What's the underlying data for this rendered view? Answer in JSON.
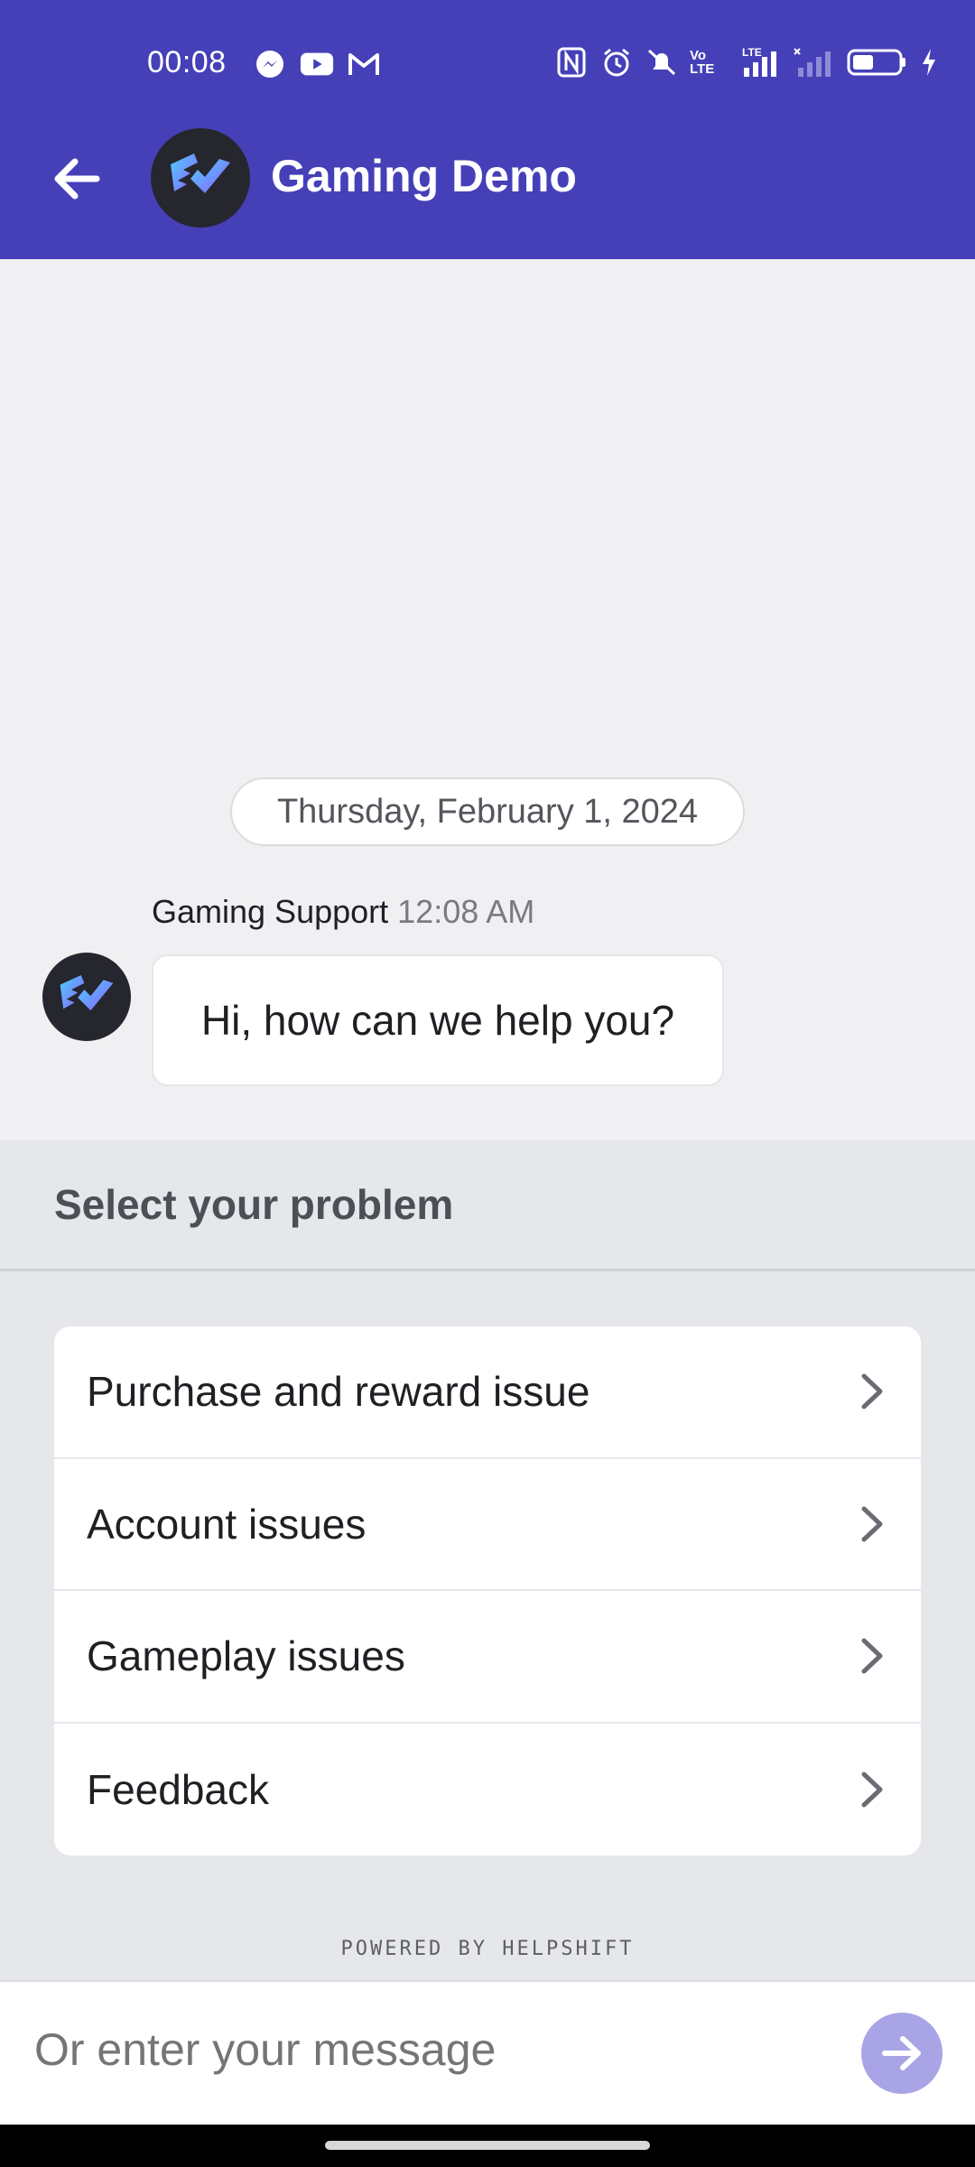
{
  "status_bar": {
    "time": "00:08",
    "left_icons": [
      "messenger-icon",
      "youtube-icon",
      "gmail-icon"
    ],
    "right_icons": [
      "nfc-icon",
      "alarm-icon",
      "mute-icon",
      "volte-icon",
      "lte-signal-icon",
      "no-signal-icon",
      "battery-icon",
      "charging-icon"
    ],
    "volte_text": "Vo LTE",
    "lte_text": "LTE"
  },
  "header": {
    "title": "Gaming Demo",
    "background": "#4540b8"
  },
  "chat": {
    "date": "Thursday, February 1, 2024",
    "message": {
      "sender": "Gaming Support",
      "time": "12:08 AM",
      "text": "Hi, how can we help you?"
    }
  },
  "options": {
    "heading": "Select your problem",
    "items": [
      {
        "label": "Purchase and reward issue"
      },
      {
        "label": "Account issues"
      },
      {
        "label": "Gameplay issues"
      },
      {
        "label": "Feedback"
      }
    ]
  },
  "footer": {
    "powered_by": "POWERED BY HELPSHIFT"
  },
  "composer": {
    "placeholder": "Or enter your message",
    "value": "",
    "send_color": "#a8a4e6"
  }
}
